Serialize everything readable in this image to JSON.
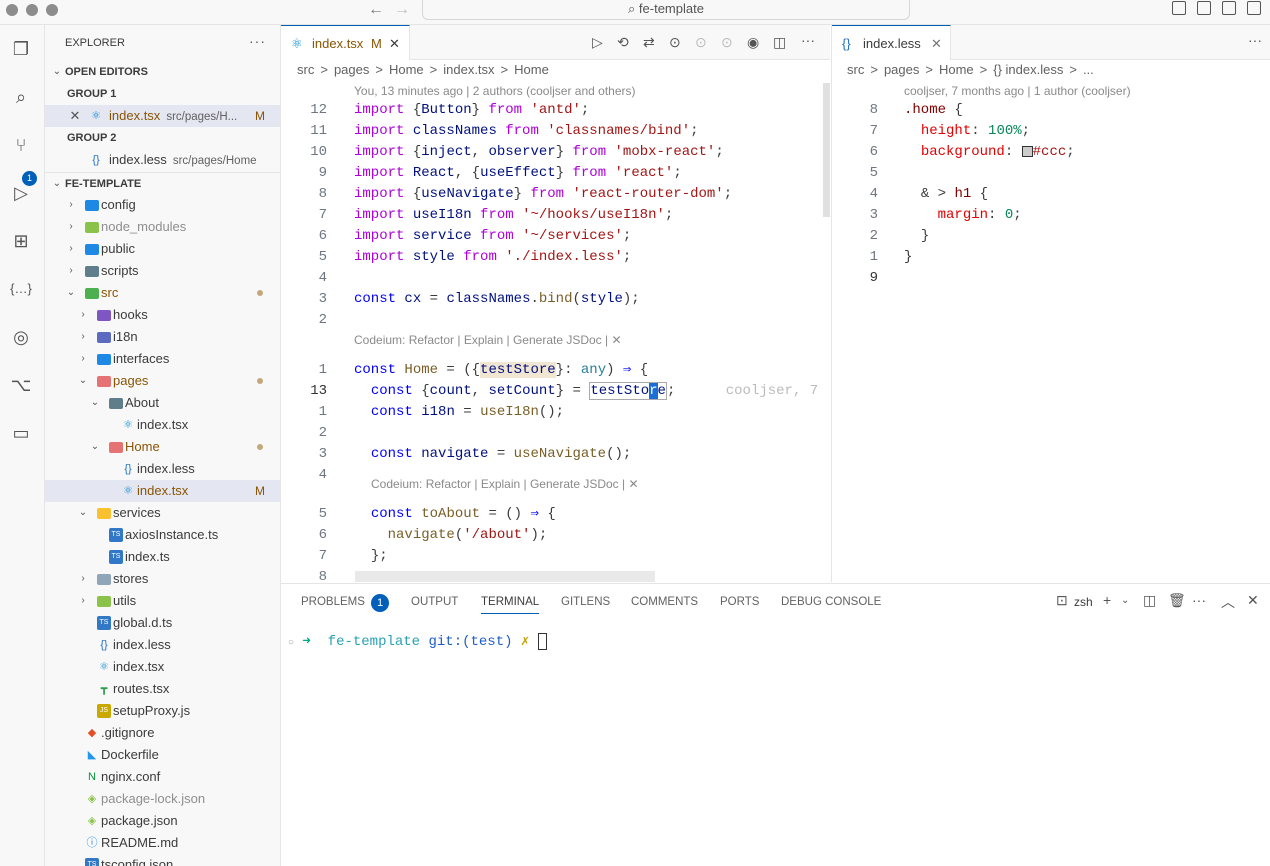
{
  "window": {
    "title": "fe-template"
  },
  "explorer": {
    "title": "EXPLORER",
    "open_editors": "OPEN EDITORS",
    "group1": "GROUP 1",
    "group2": "GROUP 2",
    "project": "FE-TEMPLATE",
    "open1": {
      "name": "index.tsx",
      "path": "src/pages/H...",
      "status": "M"
    },
    "open2": {
      "name": "index.less",
      "path": "src/pages/Home"
    },
    "tree": [
      {
        "label": "config",
        "depth": 1,
        "type": "folder"
      },
      {
        "label": "node_modules",
        "depth": 1,
        "type": "folder"
      },
      {
        "label": "public",
        "depth": 1,
        "type": "folder"
      },
      {
        "label": "scripts",
        "depth": 1,
        "type": "folder"
      },
      {
        "label": "src",
        "depth": 1,
        "type": "folder-open"
      },
      {
        "label": "hooks",
        "depth": 2,
        "type": "folder"
      },
      {
        "label": "i18n",
        "depth": 2,
        "type": "folder"
      },
      {
        "label": "interfaces",
        "depth": 2,
        "type": "folder"
      },
      {
        "label": "pages",
        "depth": 2,
        "type": "folder-open"
      },
      {
        "label": "About",
        "depth": 3,
        "type": "folder-open"
      },
      {
        "label": "index.tsx",
        "depth": 4,
        "type": "react"
      },
      {
        "label": "Home",
        "depth": 3,
        "type": "folder-open"
      },
      {
        "label": "index.less",
        "depth": 4,
        "type": "less"
      },
      {
        "label": "index.tsx",
        "depth": 4,
        "type": "react"
      },
      {
        "label": "services",
        "depth": 2,
        "type": "folder-open"
      },
      {
        "label": "axiosInstance.ts",
        "depth": 3,
        "type": "ts"
      },
      {
        "label": "index.ts",
        "depth": 3,
        "type": "ts"
      },
      {
        "label": "stores",
        "depth": 2,
        "type": "folder"
      },
      {
        "label": "utils",
        "depth": 2,
        "type": "folder"
      },
      {
        "label": "global.d.ts",
        "depth": 2,
        "type": "ts"
      },
      {
        "label": "index.less",
        "depth": 2,
        "type": "less"
      },
      {
        "label": "index.tsx",
        "depth": 2,
        "type": "react"
      },
      {
        "label": "routes.tsx",
        "depth": 2,
        "type": "route"
      },
      {
        "label": "setupProxy.js",
        "depth": 2,
        "type": "js"
      },
      {
        "label": ".gitignore",
        "depth": 1,
        "type": "git"
      },
      {
        "label": "Dockerfile",
        "depth": 1,
        "type": "docker"
      },
      {
        "label": "nginx.conf",
        "depth": 1,
        "type": "nginx"
      },
      {
        "label": "package-lock.json",
        "depth": 1,
        "type": "npm"
      },
      {
        "label": "package.json",
        "depth": 1,
        "type": "npm"
      },
      {
        "label": "README.md",
        "depth": 1,
        "type": "info"
      },
      {
        "label": "tsconfig.json",
        "depth": 1,
        "type": "ts"
      }
    ]
  },
  "editor1": {
    "tab": "index.tsx",
    "tab_status": "M",
    "crumbs": [
      "src",
      ">",
      "pages",
      ">",
      "Home",
      ">",
      "index.tsx",
      ">",
      "Home"
    ],
    "blame": "You, 13 minutes ago | 2 authors (cooljser and others)",
    "lens": "Codeium: Refactor | Explain | Generate JSDoc | ✕",
    "inline_blame": "cooljser, 7"
  },
  "editor2": {
    "tab": "index.less",
    "crumbs": [
      "src",
      ">",
      "pages",
      ">",
      "Home",
      ">",
      "{} index.less",
      ">",
      "..."
    ],
    "blame": "cooljser, 7 months ago | 1 author (cooljser)"
  },
  "panel": {
    "tabs": [
      "PROBLEMS",
      "OUTPUT",
      "TERMINAL",
      "GITLENS",
      "COMMENTS",
      "PORTS",
      "DEBUG CONSOLE"
    ],
    "problems_count": "1",
    "shell": "zsh",
    "prompt_dir": "fe-template",
    "prompt_git": "git:(test)",
    "prompt_mark": "✗"
  },
  "activity_badge": "1"
}
